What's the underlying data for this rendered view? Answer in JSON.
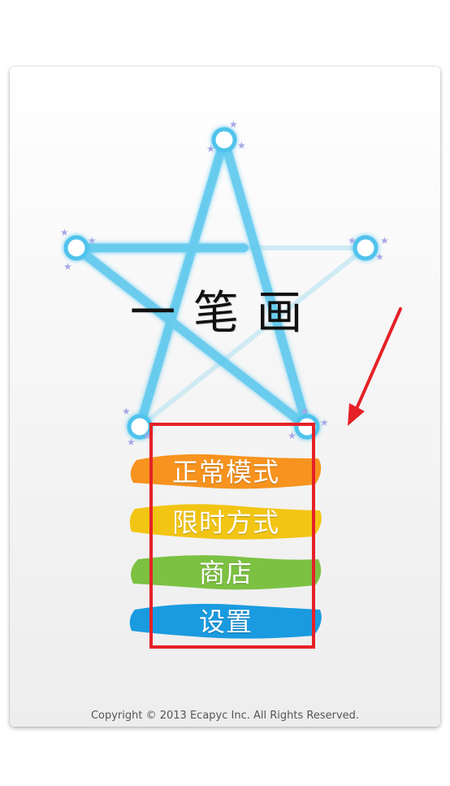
{
  "app": {
    "title": "一笔画"
  },
  "menu": {
    "items": [
      {
        "label": "正常模式",
        "color": "#f7931e"
      },
      {
        "label": "限时方式",
        "color": "#f2c514"
      },
      {
        "label": "商店",
        "color": "#7cc142"
      },
      {
        "label": "设置",
        "color": "#1a9be0"
      }
    ]
  },
  "footer": {
    "copyright": "Copyright © 2013 Ecapyc Inc. All Rights Reserved."
  },
  "annotations": {
    "highlight_color": "#e52127"
  }
}
